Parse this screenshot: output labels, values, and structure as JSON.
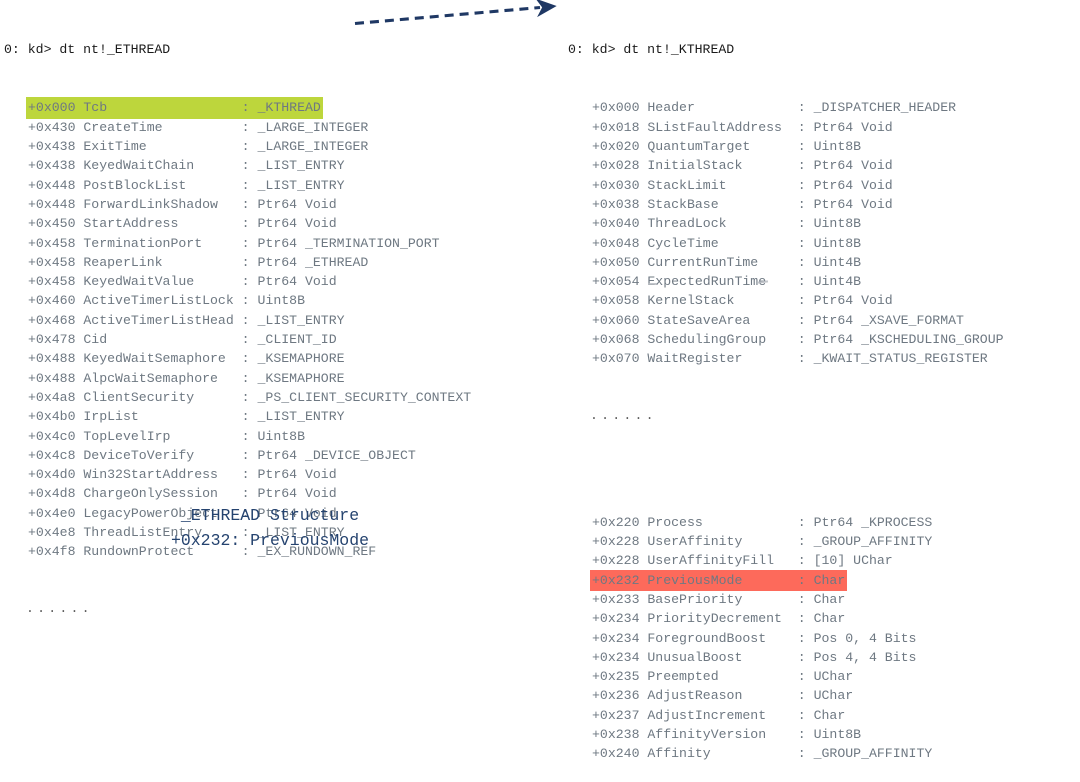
{
  "colors": {
    "highlight_green": "#bdd63c",
    "highlight_red": "#fd6a5b",
    "body_text": "#6e7882",
    "command_text": "#1a1a1a",
    "arrow": "#1f3864",
    "caption_text": "#25436f"
  },
  "left_pane": {
    "command": "0: kd> dt nt!_ETHREAD",
    "rows": [
      {
        "offset": "+0x000",
        "field": "Tcb",
        "type": "_KTHREAD",
        "highlight": "green"
      },
      {
        "offset": "+0x430",
        "field": "CreateTime",
        "type": "_LARGE_INTEGER",
        "highlight": "none"
      },
      {
        "offset": "+0x438",
        "field": "ExitTime",
        "type": "_LARGE_INTEGER",
        "highlight": "none"
      },
      {
        "offset": "+0x438",
        "field": "KeyedWaitChain",
        "type": "_LIST_ENTRY",
        "highlight": "none"
      },
      {
        "offset": "+0x448",
        "field": "PostBlockList",
        "type": "_LIST_ENTRY",
        "highlight": "none"
      },
      {
        "offset": "+0x448",
        "field": "ForwardLinkShadow",
        "type": "Ptr64 Void",
        "highlight": "none"
      },
      {
        "offset": "+0x450",
        "field": "StartAddress",
        "type": "Ptr64 Void",
        "highlight": "none"
      },
      {
        "offset": "+0x458",
        "field": "TerminationPort",
        "type": "Ptr64 _TERMINATION_PORT",
        "highlight": "none"
      },
      {
        "offset": "+0x458",
        "field": "ReaperLink",
        "type": "Ptr64 _ETHREAD",
        "highlight": "none"
      },
      {
        "offset": "+0x458",
        "field": "KeyedWaitValue",
        "type": "Ptr64 Void",
        "highlight": "none"
      },
      {
        "offset": "+0x460",
        "field": "ActiveTimerListLock",
        "type": "Uint8B",
        "highlight": "none"
      },
      {
        "offset": "+0x468",
        "field": "ActiveTimerListHead",
        "type": "_LIST_ENTRY",
        "highlight": "none"
      },
      {
        "offset": "+0x478",
        "field": "Cid",
        "type": "_CLIENT_ID",
        "highlight": "none"
      },
      {
        "offset": "+0x488",
        "field": "KeyedWaitSemaphore",
        "type": "_KSEMAPHORE",
        "highlight": "none"
      },
      {
        "offset": "+0x488",
        "field": "AlpcWaitSemaphore",
        "type": "_KSEMAPHORE",
        "highlight": "none"
      },
      {
        "offset": "+0x4a8",
        "field": "ClientSecurity",
        "type": "_PS_CLIENT_SECURITY_CONTEXT",
        "highlight": "none"
      },
      {
        "offset": "+0x4b0",
        "field": "IrpList",
        "type": "_LIST_ENTRY",
        "highlight": "none"
      },
      {
        "offset": "+0x4c0",
        "field": "TopLevelIrp",
        "type": "Uint8B",
        "highlight": "none"
      },
      {
        "offset": "+0x4c8",
        "field": "DeviceToVerify",
        "type": "Ptr64 _DEVICE_OBJECT",
        "highlight": "none"
      },
      {
        "offset": "+0x4d0",
        "field": "Win32StartAddress",
        "type": "Ptr64 Void",
        "highlight": "none"
      },
      {
        "offset": "+0x4d8",
        "field": "ChargeOnlySession",
        "type": "Ptr64 Void",
        "highlight": "none"
      },
      {
        "offset": "+0x4e0",
        "field": "LegacyPowerObject",
        "type": "Ptr64 Void",
        "highlight": "none"
      },
      {
        "offset": "+0x4e8",
        "field": "ThreadListEntry",
        "type": "_LIST_ENTRY",
        "highlight": "none"
      },
      {
        "offset": "+0x4f8",
        "field": "RundownProtect",
        "type": "_EX_RUNDOWN_REF",
        "highlight": "none"
      }
    ],
    "ellipsis": "......"
  },
  "right_pane": {
    "command": "0: kd> dt nt!_KTHREAD",
    "rows_top": [
      {
        "offset": "+0x000",
        "field": "Header",
        "type": "_DISPATCHER_HEADER",
        "highlight": "none"
      },
      {
        "offset": "+0x018",
        "field": "SListFaultAddress",
        "type": "Ptr64 Void",
        "highlight": "none"
      },
      {
        "offset": "+0x020",
        "field": "QuantumTarget",
        "type": "Uint8B",
        "highlight": "none"
      },
      {
        "offset": "+0x028",
        "field": "InitialStack",
        "type": "Ptr64 Void",
        "highlight": "none"
      },
      {
        "offset": "+0x030",
        "field": "StackLimit",
        "type": "Ptr64 Void",
        "highlight": "none"
      },
      {
        "offset": "+0x038",
        "field": "StackBase",
        "type": "Ptr64 Void",
        "highlight": "none"
      },
      {
        "offset": "+0x040",
        "field": "ThreadLock",
        "type": "Uint8B",
        "highlight": "none"
      },
      {
        "offset": "+0x048",
        "field": "CycleTime",
        "type": "Uint8B",
        "highlight": "none"
      },
      {
        "offset": "+0x050",
        "field": "CurrentRunTime",
        "type": "Uint4B",
        "highlight": "none"
      },
      {
        "offset": "+0x054",
        "field": "ExpectedRunTime",
        "type": "Uint4B",
        "highlight": "none"
      },
      {
        "offset": "+0x058",
        "field": "KernelStack",
        "type": "Ptr64 Void",
        "highlight": "none"
      },
      {
        "offset": "+0x060",
        "field": "StateSaveArea",
        "type": "Ptr64 _XSAVE_FORMAT",
        "highlight": "none"
      },
      {
        "offset": "+0x068",
        "field": "SchedulingGroup",
        "type": "Ptr64 _KSCHEDULING_GROUP",
        "highlight": "none"
      },
      {
        "offset": "+0x070",
        "field": "WaitRegister",
        "type": "_KWAIT_STATUS_REGISTER",
        "highlight": "none"
      }
    ],
    "ellipsis": "......",
    "rows_bottom": [
      {
        "offset": "+0x220",
        "field": "Process",
        "type": "Ptr64 _KPROCESS",
        "highlight": "none"
      },
      {
        "offset": "+0x228",
        "field": "UserAffinity",
        "type": "_GROUP_AFFINITY",
        "highlight": "none"
      },
      {
        "offset": "+0x228",
        "field": "UserAffinityFill",
        "type": "[10] UChar",
        "highlight": "none"
      },
      {
        "offset": "+0x232",
        "field": "PreviousMode",
        "type": "Char",
        "highlight": "red"
      },
      {
        "offset": "+0x233",
        "field": "BasePriority",
        "type": "Char",
        "highlight": "none"
      },
      {
        "offset": "+0x234",
        "field": "PriorityDecrement",
        "type": "Char",
        "highlight": "none"
      },
      {
        "offset": "+0x234",
        "field": "ForegroundBoost",
        "type": "Pos 0, 4 Bits",
        "highlight": "none"
      },
      {
        "offset": "+0x234",
        "field": "UnusualBoost",
        "type": "Pos 4, 4 Bits",
        "highlight": "none"
      },
      {
        "offset": "+0x235",
        "field": "Preempted",
        "type": "UChar",
        "highlight": "none"
      },
      {
        "offset": "+0x236",
        "field": "AdjustReason",
        "type": "UChar",
        "highlight": "none"
      },
      {
        "offset": "+0x237",
        "field": "AdjustIncrement",
        "type": "Char",
        "highlight": "none"
      },
      {
        "offset": "+0x238",
        "field": "AffinityVersion",
        "type": "Uint8B",
        "highlight": "none"
      },
      {
        "offset": "+0x240",
        "field": "Affinity",
        "type": "_GROUP_AFFINITY",
        "highlight": "none"
      }
    ]
  },
  "caption": {
    "title": "_ETHREAD Structure",
    "subtitle": "+0x232: PreviousMode"
  }
}
